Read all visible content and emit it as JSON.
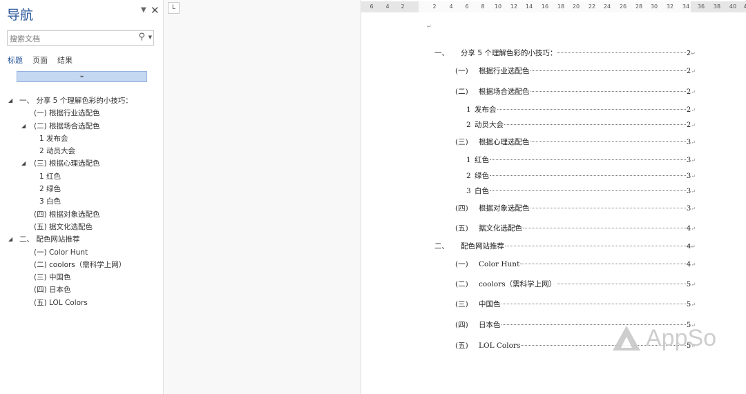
{
  "nav": {
    "title": "导航",
    "search_placeholder": "搜索文档",
    "tabs": [
      "标题",
      "页面",
      "结果"
    ],
    "bar_glyph": "≖",
    "tree": [
      {
        "label": "一、 分享 5 个理解色彩的小技巧：",
        "level": 1,
        "expand": true
      },
      {
        "label": "(一)  根据行业选配色",
        "level": 2
      },
      {
        "label": "(二)  根据场合选配色",
        "level": 2,
        "expand": true
      },
      {
        "label": "1 发布会",
        "level": 3
      },
      {
        "label": "2 动员大会",
        "level": 3
      },
      {
        "label": "(三)  根据心理选配色",
        "level": 2,
        "expand": true
      },
      {
        "label": "1 红色",
        "level": 3
      },
      {
        "label": "2 绿色",
        "level": 3
      },
      {
        "label": "3 白色",
        "level": 3
      },
      {
        "label": "(四)  根据对象选配色",
        "level": 2
      },
      {
        "label": "(五)  据文化选配色",
        "level": 2
      },
      {
        "label": "二、 配色网站推荐",
        "level": 1,
        "expand": true
      },
      {
        "label": "(一)  Color Hunt",
        "level": 2
      },
      {
        "label": "(二)  coolors（需科学上网）",
        "level": 2
      },
      {
        "label": "(三)  中国色",
        "level": 2
      },
      {
        "label": "(四)  日本色",
        "level": 2
      },
      {
        "label": "(五)  LOL Colors",
        "level": 2
      }
    ]
  },
  "tab_selector": "L",
  "ruler_ticks": [
    "6",
    "4",
    "2",
    "2",
    "4",
    "6",
    "8",
    "10",
    "12",
    "14",
    "16",
    "18",
    "20",
    "22",
    "24",
    "26",
    "28",
    "30",
    "32",
    "34",
    "36",
    "38",
    "40",
    "4"
  ],
  "document": {
    "para_mark": "↵",
    "toc": [
      {
        "num": "一、",
        "text": "分享 5 个理解色彩的小技巧：",
        "page": "2",
        "level": 1
      },
      {
        "num": "(一)",
        "text": "根据行业选配色",
        "page": "2",
        "level": 2
      },
      {
        "num": "(二)",
        "text": "根据场合选配色",
        "page": "2",
        "level": 2
      },
      {
        "num": "1",
        "text": "发布会",
        "page": "2",
        "level": 3
      },
      {
        "num": "2",
        "text": "动员大会",
        "page": "2",
        "level": 3
      },
      {
        "num": "(三)",
        "text": "根据心理选配色",
        "page": "3",
        "level": 2
      },
      {
        "num": "1",
        "text": "红色",
        "page": "3",
        "level": 3
      },
      {
        "num": "2",
        "text": "绿色",
        "page": "3",
        "level": 3
      },
      {
        "num": "3",
        "text": "白色",
        "page": "3",
        "level": 3
      },
      {
        "num": "(四)",
        "text": "根据对象选配色",
        "page": "3",
        "level": 2
      },
      {
        "num": "(五)",
        "text": "据文化选配色",
        "page": "4",
        "level": 2
      },
      {
        "num": "二、",
        "text": "配色网站推荐",
        "page": "4",
        "level": 1
      },
      {
        "num": "(一)",
        "text": "Color Hunt",
        "page": "4",
        "level": 2
      },
      {
        "num": "(二)",
        "text": "coolors（需科学上网）",
        "page": "5",
        "level": 2
      },
      {
        "num": "(三)",
        "text": "中国色",
        "page": "5",
        "level": 2
      },
      {
        "num": "(四)",
        "text": "日本色",
        "page": "5",
        "level": 2
      },
      {
        "num": "(五)",
        "text": "LOL Colors",
        "page": "5",
        "level": 2
      }
    ]
  },
  "watermark": "AppSo",
  "colors": {
    "accent": "#2b579a",
    "bar": "#c5d8f2"
  }
}
